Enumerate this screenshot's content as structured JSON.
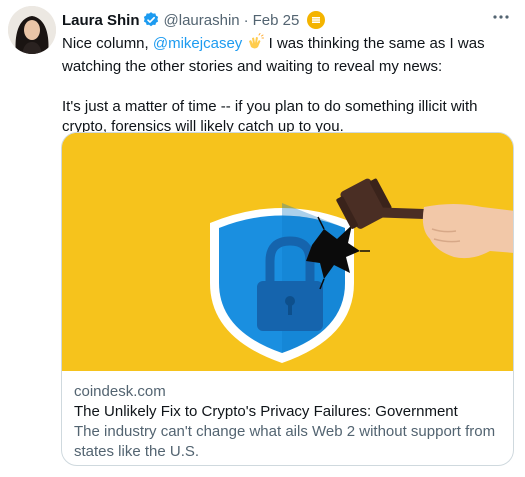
{
  "author": {
    "name": "Laura Shin",
    "handle": "@laurashin",
    "separator": "·",
    "date": "Feb 25"
  },
  "icons": {
    "verified": "verified-badge-icon",
    "coin": "coin-emoji-icon",
    "clap": "clapping-hands-emoji-icon",
    "more": "more-options-icon"
  },
  "colors": {
    "link": "#1d9bf0",
    "verified": "#1d9bf0",
    "card_background": "#f6c31c",
    "shield": "#1a8fe0"
  },
  "tweet": {
    "line1_before": "Nice column, ",
    "mention": "@mikejcasey",
    "line1_after": " I was thinking the same as I was watching the other stories and waiting to reveal my news:",
    "paragraph2": "It's just a matter of time -- if you plan to do something illicit with crypto, forensics will likely catch up to you."
  },
  "card": {
    "domain": "coindesk.com",
    "title": "The Unlikely Fix to Crypto's Privacy Failures: Government",
    "description": "The industry can't change what ails Web 2 without support from states like the U.S."
  }
}
